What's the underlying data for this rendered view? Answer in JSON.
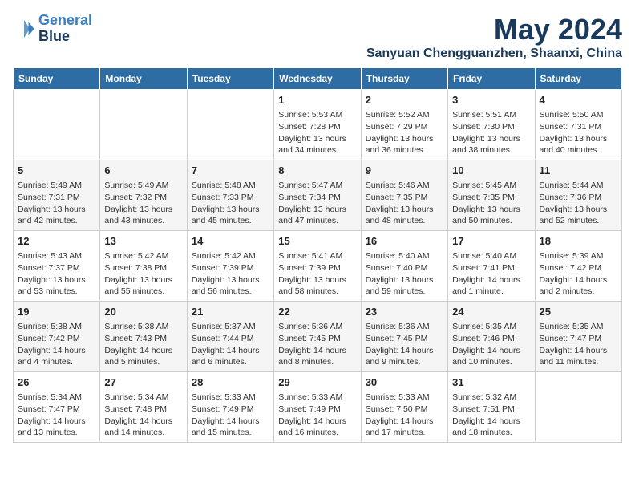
{
  "logo": {
    "line1": "General",
    "line2": "Blue"
  },
  "title": "May 2024",
  "location": "Sanyuan Chengguanzhen, Shaanxi, China",
  "days_of_week": [
    "Sunday",
    "Monday",
    "Tuesday",
    "Wednesday",
    "Thursday",
    "Friday",
    "Saturday"
  ],
  "weeks": [
    [
      {
        "day": "",
        "content": ""
      },
      {
        "day": "",
        "content": ""
      },
      {
        "day": "",
        "content": ""
      },
      {
        "day": "1",
        "content": "Sunrise: 5:53 AM\nSunset: 7:28 PM\nDaylight: 13 hours and 34 minutes."
      },
      {
        "day": "2",
        "content": "Sunrise: 5:52 AM\nSunset: 7:29 PM\nDaylight: 13 hours and 36 minutes."
      },
      {
        "day": "3",
        "content": "Sunrise: 5:51 AM\nSunset: 7:30 PM\nDaylight: 13 hours and 38 minutes."
      },
      {
        "day": "4",
        "content": "Sunrise: 5:50 AM\nSunset: 7:31 PM\nDaylight: 13 hours and 40 minutes."
      }
    ],
    [
      {
        "day": "5",
        "content": "Sunrise: 5:49 AM\nSunset: 7:31 PM\nDaylight: 13 hours and 42 minutes."
      },
      {
        "day": "6",
        "content": "Sunrise: 5:49 AM\nSunset: 7:32 PM\nDaylight: 13 hours and 43 minutes."
      },
      {
        "day": "7",
        "content": "Sunrise: 5:48 AM\nSunset: 7:33 PM\nDaylight: 13 hours and 45 minutes."
      },
      {
        "day": "8",
        "content": "Sunrise: 5:47 AM\nSunset: 7:34 PM\nDaylight: 13 hours and 47 minutes."
      },
      {
        "day": "9",
        "content": "Sunrise: 5:46 AM\nSunset: 7:35 PM\nDaylight: 13 hours and 48 minutes."
      },
      {
        "day": "10",
        "content": "Sunrise: 5:45 AM\nSunset: 7:35 PM\nDaylight: 13 hours and 50 minutes."
      },
      {
        "day": "11",
        "content": "Sunrise: 5:44 AM\nSunset: 7:36 PM\nDaylight: 13 hours and 52 minutes."
      }
    ],
    [
      {
        "day": "12",
        "content": "Sunrise: 5:43 AM\nSunset: 7:37 PM\nDaylight: 13 hours and 53 minutes."
      },
      {
        "day": "13",
        "content": "Sunrise: 5:42 AM\nSunset: 7:38 PM\nDaylight: 13 hours and 55 minutes."
      },
      {
        "day": "14",
        "content": "Sunrise: 5:42 AM\nSunset: 7:39 PM\nDaylight: 13 hours and 56 minutes."
      },
      {
        "day": "15",
        "content": "Sunrise: 5:41 AM\nSunset: 7:39 PM\nDaylight: 13 hours and 58 minutes."
      },
      {
        "day": "16",
        "content": "Sunrise: 5:40 AM\nSunset: 7:40 PM\nDaylight: 13 hours and 59 minutes."
      },
      {
        "day": "17",
        "content": "Sunrise: 5:40 AM\nSunset: 7:41 PM\nDaylight: 14 hours and 1 minute."
      },
      {
        "day": "18",
        "content": "Sunrise: 5:39 AM\nSunset: 7:42 PM\nDaylight: 14 hours and 2 minutes."
      }
    ],
    [
      {
        "day": "19",
        "content": "Sunrise: 5:38 AM\nSunset: 7:42 PM\nDaylight: 14 hours and 4 minutes."
      },
      {
        "day": "20",
        "content": "Sunrise: 5:38 AM\nSunset: 7:43 PM\nDaylight: 14 hours and 5 minutes."
      },
      {
        "day": "21",
        "content": "Sunrise: 5:37 AM\nSunset: 7:44 PM\nDaylight: 14 hours and 6 minutes."
      },
      {
        "day": "22",
        "content": "Sunrise: 5:36 AM\nSunset: 7:45 PM\nDaylight: 14 hours and 8 minutes."
      },
      {
        "day": "23",
        "content": "Sunrise: 5:36 AM\nSunset: 7:45 PM\nDaylight: 14 hours and 9 minutes."
      },
      {
        "day": "24",
        "content": "Sunrise: 5:35 AM\nSunset: 7:46 PM\nDaylight: 14 hours and 10 minutes."
      },
      {
        "day": "25",
        "content": "Sunrise: 5:35 AM\nSunset: 7:47 PM\nDaylight: 14 hours and 11 minutes."
      }
    ],
    [
      {
        "day": "26",
        "content": "Sunrise: 5:34 AM\nSunset: 7:47 PM\nDaylight: 14 hours and 13 minutes."
      },
      {
        "day": "27",
        "content": "Sunrise: 5:34 AM\nSunset: 7:48 PM\nDaylight: 14 hours and 14 minutes."
      },
      {
        "day": "28",
        "content": "Sunrise: 5:33 AM\nSunset: 7:49 PM\nDaylight: 14 hours and 15 minutes."
      },
      {
        "day": "29",
        "content": "Sunrise: 5:33 AM\nSunset: 7:49 PM\nDaylight: 14 hours and 16 minutes."
      },
      {
        "day": "30",
        "content": "Sunrise: 5:33 AM\nSunset: 7:50 PM\nDaylight: 14 hours and 17 minutes."
      },
      {
        "day": "31",
        "content": "Sunrise: 5:32 AM\nSunset: 7:51 PM\nDaylight: 14 hours and 18 minutes."
      },
      {
        "day": "",
        "content": ""
      }
    ]
  ]
}
